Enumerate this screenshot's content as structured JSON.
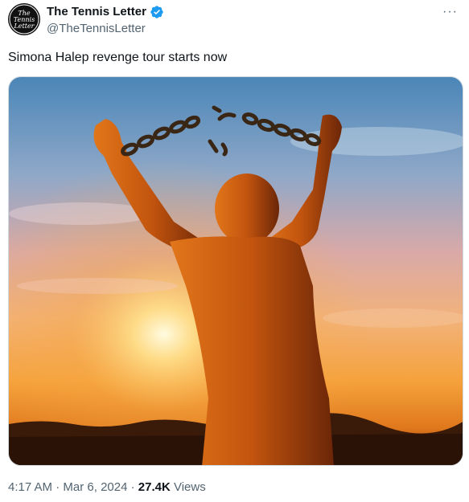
{
  "author": {
    "avatar_text": [
      "The",
      "Tennis",
      "Letter"
    ],
    "display_name": "The Tennis Letter",
    "handle": "@TheTennisLetter",
    "verified": true
  },
  "more_label": "···",
  "tweet": {
    "text": "Simona Halep revenge tour starts now",
    "image_alt": "Silhouette of a man breaking chains against a sunset sky"
  },
  "meta": {
    "time": "4:17 AM",
    "sep1": " · ",
    "date": "Mar 6, 2024",
    "sep2": " · ",
    "views_count": "27.4K",
    "views_label": " Views"
  },
  "colors": {
    "text": "#0f1419",
    "muted": "#536471",
    "verified": "#1d9bf0"
  }
}
